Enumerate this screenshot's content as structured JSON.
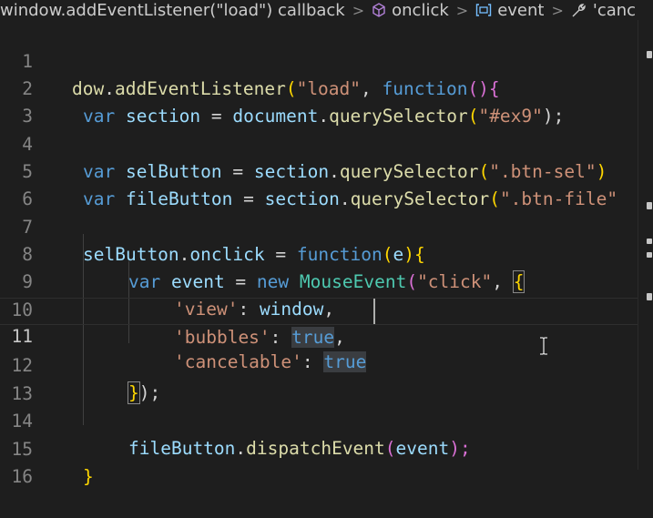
{
  "breadcrumb": {
    "items": [
      {
        "label": "window.addEventListener(\"load\") callback",
        "icon": ""
      },
      {
        "label": "onclick",
        "icon": "cube-icon"
      },
      {
        "label": "event",
        "icon": "variable-icon"
      },
      {
        "label": "'canc",
        "icon": "wrench-icon"
      }
    ],
    "separator": ">"
  },
  "editor": {
    "current_line": 11,
    "lines": [
      {
        "n": "1"
      },
      {
        "n": "2"
      },
      {
        "n": "3"
      },
      {
        "n": "4"
      },
      {
        "n": "5"
      },
      {
        "n": "6"
      },
      {
        "n": "7"
      },
      {
        "n": "8"
      },
      {
        "n": "9"
      },
      {
        "n": "10"
      },
      {
        "n": "11"
      },
      {
        "n": "12"
      },
      {
        "n": "13"
      },
      {
        "n": "14"
      },
      {
        "n": "15"
      },
      {
        "n": "16"
      }
    ],
    "tokens": {
      "l1": [
        "dow",
        ".",
        "addEventListener",
        "(",
        "\"load\"",
        ", ",
        "function",
        "(){"
      ],
      "l2": [
        "var",
        " ",
        "section",
        " = ",
        "document",
        ".",
        "querySelector",
        "(",
        "\"#ex9\"",
        ");"
      ],
      "l4": [
        "var",
        " ",
        "selButton",
        " = ",
        "section",
        ".",
        "querySelector",
        "(",
        "\".btn-sel\"",
        ")"
      ],
      "l5": [
        "var",
        " ",
        "fileButton",
        " = ",
        "section",
        ".",
        "querySelector",
        "(",
        "\".btn-file\""
      ],
      "l7": [
        "selButton",
        ".",
        "onclick",
        " = ",
        "function",
        "(",
        "e",
        "){"
      ],
      "l8": [
        "var",
        " ",
        "event",
        " = ",
        "new",
        " ",
        "MouseEvent",
        "(",
        "\"click\"",
        ", ",
        "{"
      ],
      "l9": [
        "'view'",
        ": ",
        "window",
        ","
      ],
      "l10": [
        "'bubbles'",
        ": ",
        "true",
        ","
      ],
      "l11": [
        "'cancelable'",
        ": ",
        "true"
      ],
      "l12": [
        "}",
        ");"
      ],
      "l14": [
        "fileButton",
        ".",
        "dispatchEvent",
        "(",
        "event",
        ");"
      ],
      "l15": [
        "}"
      ]
    }
  },
  "colors": {
    "background": "#1e1e1e",
    "keyword": "#569cd6",
    "identifier": "#9cdcfe",
    "function": "#dcdcaa",
    "string": "#ce9178",
    "class": "#4ec9b0"
  }
}
